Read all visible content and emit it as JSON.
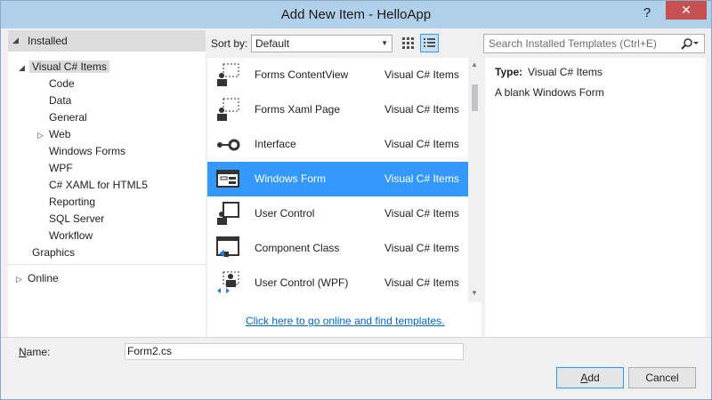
{
  "window": {
    "title": "Add New Item - HelloApp",
    "help_glyph": "?",
    "close_glyph": "✕"
  },
  "left": {
    "installed_label": "Installed",
    "tree": [
      {
        "label": "Visual C# Items",
        "level": 1,
        "expanded": true,
        "selected": true
      },
      {
        "label": "Code",
        "level": 2
      },
      {
        "label": "Data",
        "level": 2
      },
      {
        "label": "General",
        "level": 2
      },
      {
        "label": "Web",
        "level": 2,
        "expandable": true
      },
      {
        "label": "Windows Forms",
        "level": 2
      },
      {
        "label": "WPF",
        "level": 2
      },
      {
        "label": "C# XAML for HTML5",
        "level": 2
      },
      {
        "label": "Reporting",
        "level": 2
      },
      {
        "label": "SQL Server",
        "level": 2
      },
      {
        "label": "Workflow",
        "level": 2
      },
      {
        "label": "Graphics",
        "level": 1
      }
    ],
    "online_label": "Online"
  },
  "toolbar": {
    "sort_label": "Sort by:",
    "sort_value": "Default"
  },
  "templates": [
    {
      "name": "Forms ContentView",
      "category": "Visual C# Items",
      "icon": "forms-contentview-icon"
    },
    {
      "name": "Forms Xaml Page",
      "category": "Visual C# Items",
      "icon": "forms-xaml-page-icon"
    },
    {
      "name": "Interface",
      "category": "Visual C# Items",
      "icon": "interface-icon"
    },
    {
      "name": "Windows Form",
      "category": "Visual C# Items",
      "icon": "windows-form-icon",
      "selected": true
    },
    {
      "name": "User Control",
      "category": "Visual C# Items",
      "icon": "user-control-icon"
    },
    {
      "name": "Component Class",
      "category": "Visual C# Items",
      "icon": "component-class-icon"
    },
    {
      "name": "User Control (WPF)",
      "category": "Visual C# Items",
      "icon": "user-control-wpf-icon"
    }
  ],
  "online_link": "Click here to go online and find templates.",
  "search": {
    "placeholder": "Search Installed Templates (Ctrl+E)"
  },
  "details": {
    "type_label": "Type:",
    "type_value": "Visual C# Items",
    "description": "A blank Windows Form"
  },
  "bottom": {
    "name_label": "Name:",
    "name_value": "Form2.cs",
    "add_label": "Add",
    "cancel_label": "Cancel"
  },
  "colors": {
    "selection": "#3399ff",
    "titlebar": "#b0cfe9",
    "close": "#c75050",
    "link": "#0066cc"
  }
}
